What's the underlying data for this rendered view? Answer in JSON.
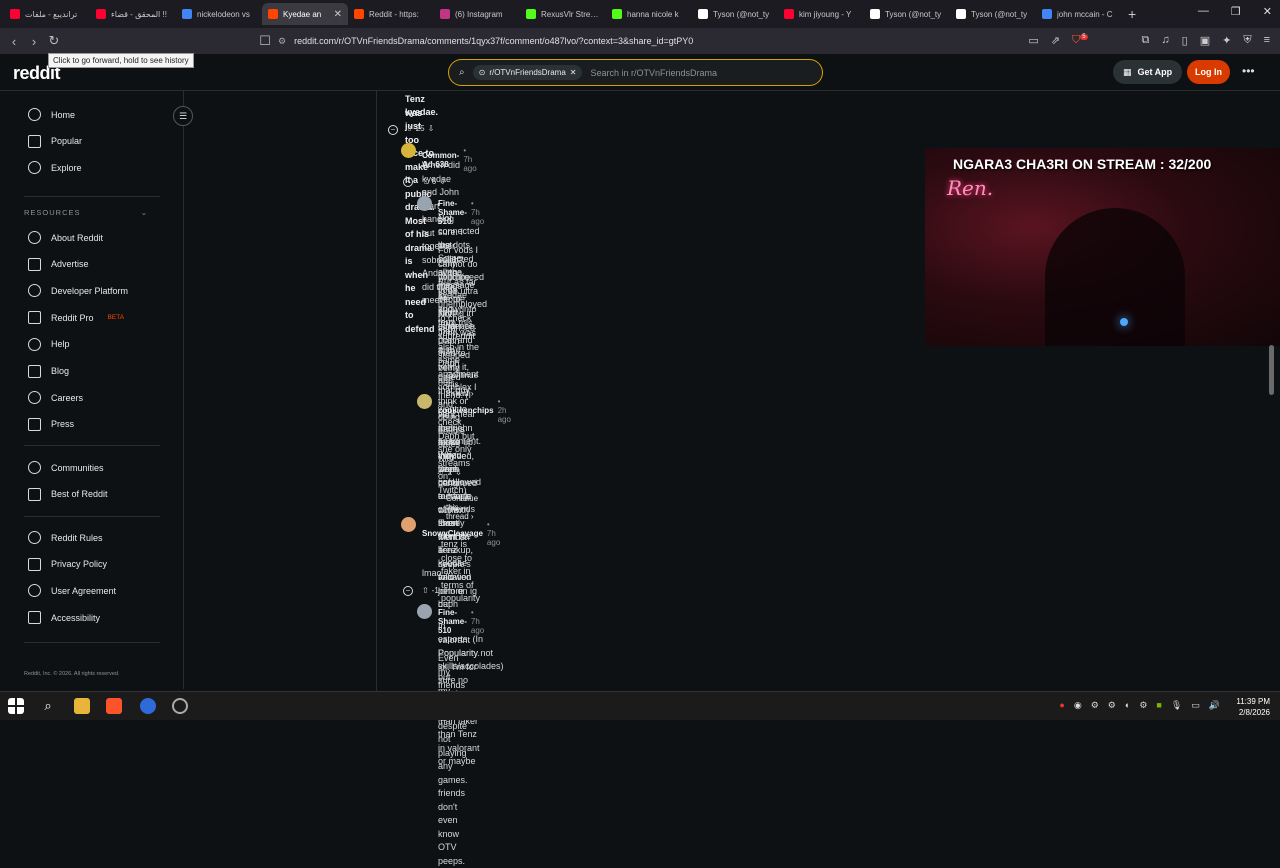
{
  "browser": {
    "tabs": [
      {
        "label": "ترانديبع - ملفات",
        "fav": "#ff0033"
      },
      {
        "label": "المحقق - قضاء !!",
        "fav": "#ff0033"
      },
      {
        "label": "nickelodeon vs",
        "fav": "#4285f4"
      },
      {
        "label": "Kyedae an",
        "fav": "#ff4500",
        "active": true
      },
      {
        "label": "Reddit - https:",
        "fav": "#ff4500"
      },
      {
        "label": "(6) Instagram",
        "fav": "#c13584"
      },
      {
        "label": "RexusVlr Stream",
        "fav": "#53fc18"
      },
      {
        "label": "hanna nicole k",
        "fav": "#53fc18"
      },
      {
        "label": "Tyson (@not_ty",
        "fav": "#ffffff"
      },
      {
        "label": "kim jiyoung - Y",
        "fav": "#ff0033"
      },
      {
        "label": "Tyson (@not_ty",
        "fav": "#ffffff"
      },
      {
        "label": "Tyson (@not_ty",
        "fav": "#ffffff"
      },
      {
        "label": "john mccain - C",
        "fav": "#4285f4"
      }
    ],
    "new_tab": "+",
    "url": "reddit.com/r/OTVnFriendsDrama/comments/1qyx37f/comment/o487lvo/?context=3&share_id=gtPY0",
    "tooltip": "Click to go forward, hold to see history",
    "shield_badge": "5"
  },
  "header": {
    "logo": "reddit",
    "subreddit_chip": "r/OTVnFriendsDrama",
    "search_placeholder": "Search in r/OTVnFriendsDrama",
    "get_app": "Get App",
    "login": "Log In",
    "more": "•••"
  },
  "sidebar": {
    "top": [
      {
        "label": "Home",
        "icon": "home-icon"
      },
      {
        "label": "Popular",
        "icon": "popular-icon"
      },
      {
        "label": "Explore",
        "icon": "explore-icon"
      }
    ],
    "resources_header": "RESOURCES",
    "resources": [
      {
        "label": "About Reddit",
        "icon": "about-icon"
      },
      {
        "label": "Advertise",
        "icon": "advertise-icon"
      },
      {
        "label": "Developer Platform",
        "icon": "developer-icon"
      },
      {
        "label": "Reddit Pro",
        "icon": "pro-icon",
        "badge": "BETA"
      },
      {
        "label": "Help",
        "icon": "help-icon"
      },
      {
        "label": "Blog",
        "icon": "blog-icon"
      },
      {
        "label": "Careers",
        "icon": "careers-icon"
      },
      {
        "label": "Press",
        "icon": "press-icon"
      }
    ],
    "community": [
      {
        "label": "Communities",
        "icon": "communities-icon"
      },
      {
        "label": "Best of Reddit",
        "icon": "best-icon"
      }
    ],
    "legal": [
      {
        "label": "Reddit Rules",
        "icon": "rules-icon"
      },
      {
        "label": "Privacy Policy",
        "icon": "privacy-icon"
      },
      {
        "label": "User Agreement",
        "icon": "agreement-icon"
      },
      {
        "label": "Accessibility",
        "icon": "accessibility-icon"
      }
    ],
    "copyright": "Reddit, Inc. © 2026. All rights reserved."
  },
  "thread": {
    "top_comment_text_1": "Tenz was just too nice to make it a public drama. Most of his drama is when he need to defend",
    "top_comment_text_2": "kyedae.",
    "top_votes": "25",
    "c1": {
      "user": "Common-Ad-638",
      "time": "• 7h ago",
      "text": "When did kyedae and John start hanging out together sobmuch? And when did they meet?",
      "votes": "6"
    },
    "c2": {
      "user": "Fine-Shame-510",
      "time": "• 7h ago",
      "p1a": "Not sure. I just collected all the things people saying in other post and tried to verify it, and",
      "p1b": "connected the dots. Some even message me to send evidence.",
      "p2a": "For vods I cannot do twitch(need to be ultra unemployed to check that).",
      "p2b": "Only youtube vods.",
      "p3a": "But as far as I know(info from this subreddit also). Daph dated that guy and doing double dates with",
      "p3b": "kyedae and tenz.",
      "p4": "Not surprised Daph stopped being her friend. (I want to check Daph but she only streams on Twitch)",
      "p5": "John was also in the same apartment complex I think or very near their apartment.",
      "votes": "6"
    },
    "continue": "Continue this thread",
    "c3": {
      "user": "cookiesnchips",
      "time": "• 2h ago",
      "l1": "He's daph's ex so they've been hangin out for a while. Even went on a couple's vacation before daph",
      "l2": "and john broke up. When Daph unfollowed a couple of friends shortly after the breakup, kyedae and",
      "l3": "tenz included, john continued to hang out with those friends. Tenz never followed john on ig but",
      "l4": "they were cool.",
      "votes": "2"
    },
    "c4": {
      "user": "SnowyCleavage",
      "time": "• 7h ago",
      "quote": "tenz is close to faker in terms of popularity",
      "text": "lmao",
      "votes": "-1"
    },
    "c5": {
      "user": "Fine-Shame-510",
      "time": "• 7h ago",
      "l1": "In valorant Popularity. lol. I'm for sure no one is closer than faker than Tenz in valorant or maybe",
      "l2": "esports. (In Popularity not skills/accolades)",
      "l3": "Even my friends know him despite not playing any games. friends don't even know OTV peeps.",
      "l4": "but my point is."
    }
  },
  "stream": {
    "title": "NGARA3 CHA3RI ON STREAM : 32/200",
    "neon": "Ren."
  },
  "taskbar": {
    "time": "11:39 PM",
    "date": "2/8/2026"
  }
}
